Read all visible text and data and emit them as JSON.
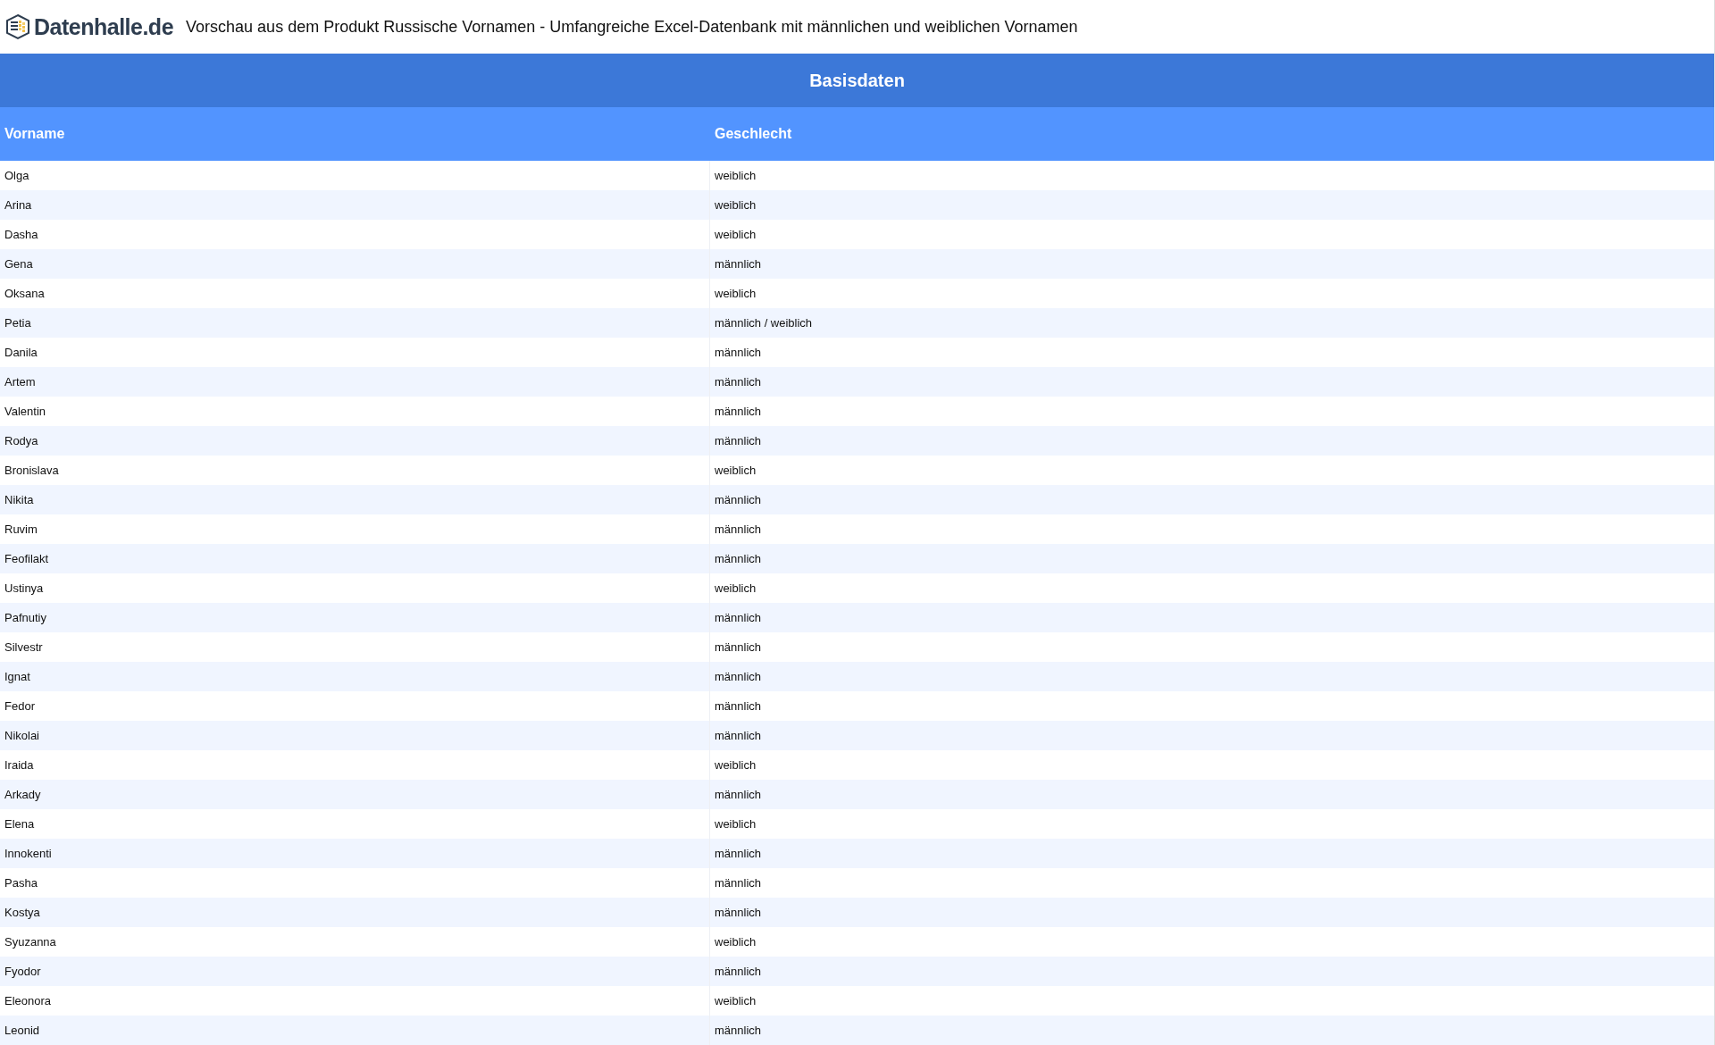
{
  "header": {
    "logo_text": "Datenhalle.de",
    "title": "Vorschau aus dem Produkt Russische Vornamen - Umfangreiche Excel-Datenbank mit männlichen und weiblichen Vornamen"
  },
  "table": {
    "caption": "Basisdaten",
    "columns": [
      "Vorname",
      "Geschlecht"
    ],
    "rows": [
      [
        "Olga",
        "weiblich"
      ],
      [
        "Arina",
        "weiblich"
      ],
      [
        "Dasha",
        "weiblich"
      ],
      [
        "Gena",
        "männlich"
      ],
      [
        "Oksana",
        "weiblich"
      ],
      [
        "Petia",
        "männlich / weiblich"
      ],
      [
        "Danila",
        "männlich"
      ],
      [
        "Artem",
        "männlich"
      ],
      [
        "Valentin",
        "männlich"
      ],
      [
        "Rodya",
        "männlich"
      ],
      [
        "Bronislava",
        "weiblich"
      ],
      [
        "Nikita",
        "männlich"
      ],
      [
        "Ruvim",
        "männlich"
      ],
      [
        "Feofilakt",
        "männlich"
      ],
      [
        "Ustinya",
        "weiblich"
      ],
      [
        "Pafnutiy",
        "männlich"
      ],
      [
        "Silvestr",
        "männlich"
      ],
      [
        "Ignat",
        "männlich"
      ],
      [
        "Fedor",
        "männlich"
      ],
      [
        "Nikolai",
        "männlich"
      ],
      [
        "Iraida",
        "weiblich"
      ],
      [
        "Arkady",
        "männlich"
      ],
      [
        "Elena",
        "weiblich"
      ],
      [
        "Innokenti",
        "männlich"
      ],
      [
        "Pasha",
        "männlich"
      ],
      [
        "Kostya",
        "männlich"
      ],
      [
        "Syuzanna",
        "weiblich"
      ],
      [
        "Fyodor",
        "männlich"
      ],
      [
        "Eleonora",
        "weiblich"
      ],
      [
        "Leonid",
        "männlich"
      ]
    ]
  }
}
